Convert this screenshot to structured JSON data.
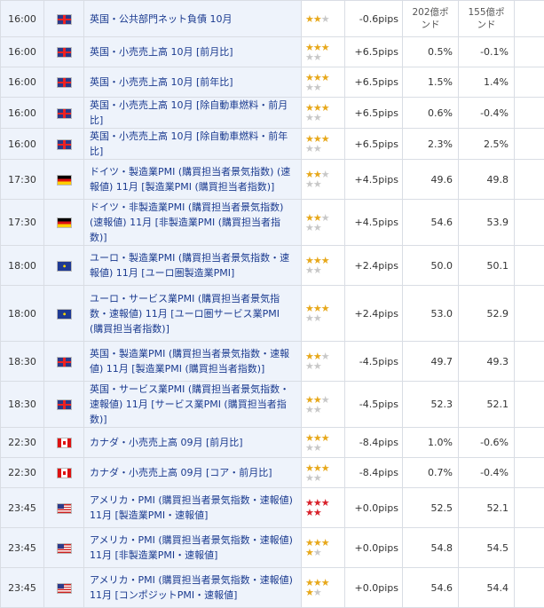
{
  "rows": [
    {
      "time": "16:00",
      "flag": "uk",
      "name": "英国・公共部門ネット負債 10月",
      "stars_top": "★★",
      "stars_top_gray": "★",
      "stars_bot": "",
      "stars_bot_gray": "",
      "star_color": "gold",
      "pips": "-0.6pips",
      "v1": "202億ポンド",
      "v2": "155億ポンド",
      "v_header": true,
      "h": 41
    },
    {
      "time": "16:00",
      "flag": "uk",
      "name": "英国・小売売上高 10月 [前月比]",
      "stars_top": "★★★",
      "stars_top_gray": "",
      "stars_bot": "",
      "stars_bot_gray": "★★",
      "star_color": "gold",
      "pips": "+6.5pips",
      "v1": "0.5%",
      "v2": "-0.1%",
      "h": 34
    },
    {
      "time": "16:00",
      "flag": "uk",
      "name": "英国・小売売上高 10月 [前年比]",
      "stars_top": "★★★",
      "stars_top_gray": "",
      "stars_bot": "",
      "stars_bot_gray": "★★",
      "star_color": "gold",
      "pips": "+6.5pips",
      "v1": "1.5%",
      "v2": "1.4%",
      "h": 34
    },
    {
      "time": "16:00",
      "flag": "uk",
      "name": "英国・小売売上高 10月 [除自動車燃料・前月比]",
      "stars_top": "★★★",
      "stars_top_gray": "",
      "stars_bot": "",
      "stars_bot_gray": "★★",
      "star_color": "gold",
      "pips": "+6.5pips",
      "v1": "0.6%",
      "v2": "-0.4%",
      "h": 34
    },
    {
      "time": "16:00",
      "flag": "uk",
      "name": "英国・小売売上高 10月 [除自動車燃料・前年比]",
      "stars_top": "★★★",
      "stars_top_gray": "",
      "stars_bot": "",
      "stars_bot_gray": "★★",
      "star_color": "gold",
      "pips": "+6.5pips",
      "v1": "2.3%",
      "v2": "2.5%",
      "h": 34
    },
    {
      "time": "17:30",
      "flag": "de",
      "name": "ドイツ・製造業PMI (購買担当者景気指数) (速報値) 11月 [製造業PMI (購買担当者指数)]",
      "stars_top": "★★",
      "stars_top_gray": "★",
      "stars_bot": "",
      "stars_bot_gray": "★★",
      "star_color": "gold",
      "pips": "+4.5pips",
      "v1": "49.6",
      "v2": "49.8",
      "h": 45
    },
    {
      "time": "17:30",
      "flag": "de",
      "name": "ドイツ・非製造業PMI (購買担当者景気指数) (速報値) 11月 [非製造業PMI (購買担当者指数)]",
      "stars_top": "★★",
      "stars_top_gray": "★",
      "stars_bot": "",
      "stars_bot_gray": "★★",
      "star_color": "gold",
      "pips": "+4.5pips",
      "v1": "54.6",
      "v2": "53.9",
      "h": 45
    },
    {
      "time": "18:00",
      "flag": "eu",
      "name": "ユーロ・製造業PMI (購買担当者景気指数・速報値) 11月 [ユーロ圏製造業PMI]",
      "stars_top": "★★★",
      "stars_top_gray": "",
      "stars_bot": "",
      "stars_bot_gray": "★★",
      "star_color": "gold",
      "pips": "+2.4pips",
      "v1": "50.0",
      "v2": "50.1",
      "h": 45
    },
    {
      "time": "18:00",
      "flag": "eu",
      "name": "ユーロ・サービス業PMI (購買担当者景気指数・速報値) 11月 [ユーロ圏サービス業PMI (購買担当者指数)]",
      "stars_top": "★★★",
      "stars_top_gray": "",
      "stars_bot": "",
      "stars_bot_gray": "★★",
      "star_color": "gold",
      "pips": "+2.4pips",
      "v1": "53.0",
      "v2": "52.9",
      "h": 63
    },
    {
      "time": "18:30",
      "flag": "uk",
      "name": "英国・製造業PMI (購買担当者景気指数・速報値) 11月 [製造業PMI (購買担当者指数)]",
      "stars_top": "★★",
      "stars_top_gray": "★",
      "stars_bot": "",
      "stars_bot_gray": "★★",
      "star_color": "gold",
      "pips": "-4.5pips",
      "v1": "49.7",
      "v2": "49.3",
      "h": 45
    },
    {
      "time": "18:30",
      "flag": "uk",
      "name": "英国・サービス業PMI (購買担当者景気指数・速報値) 11月 [サービス業PMI (購買担当者指数)]",
      "stars_top": "★★",
      "stars_top_gray": "★",
      "stars_bot": "",
      "stars_bot_gray": "★★",
      "star_color": "gold",
      "pips": "-4.5pips",
      "v1": "52.3",
      "v2": "52.1",
      "h": 45
    },
    {
      "time": "22:30",
      "flag": "ca",
      "name": "カナダ・小売売上高 09月 [前月比]",
      "stars_top": "★★★",
      "stars_top_gray": "",
      "stars_bot": "",
      "stars_bot_gray": "★★",
      "star_color": "gold",
      "pips": "-8.4pips",
      "v1": "1.0%",
      "v2": "-0.6%",
      "h": 34
    },
    {
      "time": "22:30",
      "flag": "ca",
      "name": "カナダ・小売売上高 09月 [コア・前月比]",
      "stars_top": "★★★",
      "stars_top_gray": "",
      "stars_bot": "",
      "stars_bot_gray": "★★",
      "star_color": "gold",
      "pips": "-8.4pips",
      "v1": "0.7%",
      "v2": "-0.4%",
      "h": 34
    },
    {
      "time": "23:45",
      "flag": "us",
      "name": "アメリカ・PMI (購買担当者景気指数・速報値) 11月 [製造業PMI・速報値]",
      "stars_top": "★★★",
      "stars_top_gray": "",
      "stars_bot": "★★",
      "stars_bot_gray": "",
      "star_color": "red",
      "pips": "+0.0pips",
      "v1": "52.5",
      "v2": "52.1",
      "h": 45
    },
    {
      "time": "23:45",
      "flag": "us",
      "name": "アメリカ・PMI (購買担当者景気指数・速報値) 11月 [非製造業PMI・速報値]",
      "stars_top": "★★★",
      "stars_top_gray": "",
      "stars_bot": "★",
      "stars_bot_gray": "★",
      "star_color": "gold",
      "pips": "+0.0pips",
      "v1": "54.8",
      "v2": "54.5",
      "h": 45
    },
    {
      "time": "23:45",
      "flag": "us",
      "name": "アメリカ・PMI (購買担当者景気指数・速報値) 11月 [コンポジットPMI・速報値]",
      "stars_top": "★★★",
      "stars_top_gray": "",
      "stars_bot": "★",
      "stars_bot_gray": "★",
      "star_color": "gold",
      "pips": "+0.0pips",
      "v1": "54.6",
      "v2": "54.4",
      "h": 45
    }
  ],
  "dash": "---"
}
